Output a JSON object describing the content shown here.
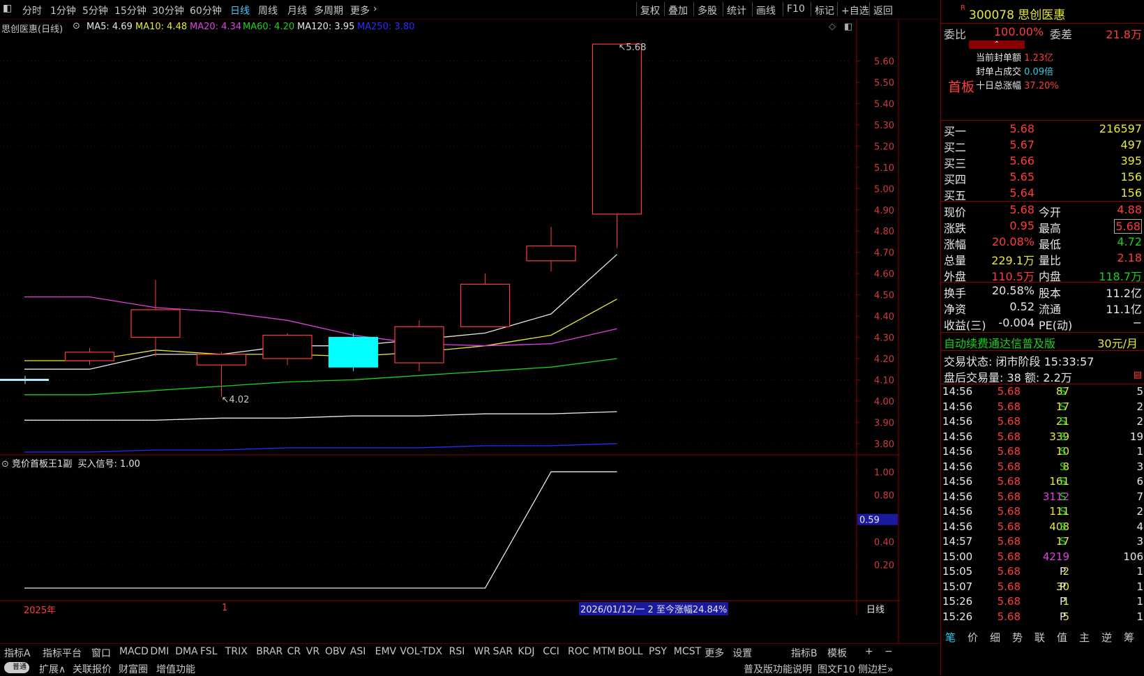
{
  "toolbar": {
    "periods": [
      "分时",
      "1分钟",
      "5分钟",
      "15分钟",
      "30分钟",
      "60分钟",
      "日线",
      "周线",
      "月线",
      "多周期",
      "更多"
    ],
    "active_period": "日线",
    "more_arrow": "›",
    "right_buttons": [
      "复权",
      "叠加",
      "多股",
      "统计",
      "画线",
      "F10",
      "标记",
      "+自选",
      "返回"
    ]
  },
  "legend": {
    "stock_title": "思创医惠(日线)",
    "ma5": "MA5: 4.69",
    "ma10": "MA10: 4.48",
    "ma20": "MA20: 4.34",
    "ma60": "MA60: 4.20",
    "ma120": "MA120: 3.95",
    "ma250": "MA250: 3.80",
    "colors": {
      "ma5": "#e6e6e6",
      "ma10": "#e8e83a",
      "ma20": "#e040e0",
      "ma60": "#19d219",
      "ma120": "#e6e6e6",
      "ma250": "#2a2aff"
    }
  },
  "chart_data": [
    {
      "type": "candlestick",
      "title": "思创医惠(日线)",
      "y_axis_ticks": [
        "5.60",
        "5.50",
        "5.40",
        "5.30",
        "5.20",
        "5.10",
        "5.00",
        "4.90",
        "4.80",
        "4.70",
        "4.60",
        "4.50",
        "4.40",
        "4.30",
        "4.20",
        "4.10",
        "4.00",
        "3.90",
        "3.80"
      ],
      "ylim": [
        3.76,
        5.72
      ],
      "candles": [
        {
          "open": 4.19,
          "close": 4.23,
          "high": 4.25,
          "low": 4.17,
          "dir": "up"
        },
        {
          "open": 4.3,
          "close": 4.43,
          "high": 4.57,
          "low": 4.21,
          "dir": "up"
        },
        {
          "open": 4.17,
          "close": 4.22,
          "high": 4.23,
          "low": 4.02,
          "dir": "up"
        },
        {
          "open": 4.2,
          "close": 4.31,
          "high": 4.32,
          "low": 4.17,
          "dir": "up"
        },
        {
          "open": 4.3,
          "close": 4.16,
          "high": 4.32,
          "low": 4.14,
          "dir": "down"
        },
        {
          "open": 4.18,
          "close": 4.35,
          "high": 4.38,
          "low": 4.14,
          "dir": "up"
        },
        {
          "open": 4.35,
          "close": 4.55,
          "high": 4.6,
          "low": 4.35,
          "dir": "up"
        },
        {
          "open": 4.66,
          "close": 4.73,
          "high": 4.82,
          "low": 4.61,
          "dir": "up"
        },
        {
          "open": 4.88,
          "close": 5.68,
          "high": 5.68,
          "low": 4.72,
          "dir": "up"
        }
      ],
      "annotations": {
        "high_label": "5.68",
        "low_label": "4.02"
      },
      "ma_series": [
        {
          "name": "MA5",
          "values": [
            4.15,
            4.22,
            4.22,
            4.26,
            4.26,
            4.29,
            4.32,
            4.41,
            4.69
          ]
        },
        {
          "name": "MA10",
          "values": [
            4.19,
            4.24,
            4.22,
            4.22,
            4.21,
            4.23,
            4.26,
            4.31,
            4.48
          ]
        },
        {
          "name": "MA20",
          "values": [
            4.49,
            4.44,
            4.42,
            4.38,
            4.31,
            4.27,
            4.26,
            4.27,
            4.34
          ]
        },
        {
          "name": "MA60",
          "values": [
            4.03,
            4.05,
            4.07,
            4.09,
            4.1,
            4.12,
            4.14,
            4.16,
            4.2
          ]
        },
        {
          "name": "MA120",
          "values": [
            3.91,
            3.91,
            3.92,
            3.92,
            3.93,
            3.93,
            3.94,
            3.94,
            3.95
          ]
        },
        {
          "name": "MA250",
          "values": [
            3.76,
            3.77,
            3.77,
            3.78,
            3.78,
            3.78,
            3.79,
            3.79,
            3.8
          ]
        }
      ]
    },
    {
      "type": "line",
      "title": "竞价首板王1副",
      "y_axis_ticks": [
        "1.00",
        "0.80",
        "0.60",
        "0.40",
        "0.20"
      ],
      "ylim": [
        -0.09,
        1.05
      ],
      "series": [
        {
          "name": "买入信号",
          "values": [
            0,
            0,
            0,
            0,
            0,
            0,
            0,
            1,
            1
          ]
        }
      ],
      "cursor_value": "0.59"
    }
  ],
  "sub_legend": {
    "title": "竞价首板王1副",
    "signal": "买入信号: 1.00"
  },
  "x_axis": {
    "year": "2025年",
    "month": "1",
    "range_text": "2026/01/12/一 2 至今涨幅24.84%",
    "period_label": "日线"
  },
  "indicator_tabs": [
    "指标A",
    "指标平台",
    "窗口",
    "MACD",
    "DMI",
    "DMA",
    "FSL",
    "TRIX",
    "BRAR",
    "CR",
    "VR",
    "OBV",
    "ASI",
    "EMV",
    "VOL-TDX",
    "RSI",
    "WR",
    "SAR",
    "KDJ",
    "CCI",
    "ROC",
    "MTM",
    "BOLL",
    "PSY",
    "MCST",
    "更多",
    "设置"
  ],
  "indicator_right": [
    "指标B",
    "模板",
    "+",
    "−"
  ],
  "bottom_bar2": {
    "toggle": "普通",
    "expand": "扩展∧",
    "related": "关联报价",
    "wealth": "财富圈",
    "valueadd": "增值功能",
    "notice": "普及版功能说明",
    "f10": "图文F10",
    "sidebar": "侧边栏»"
  },
  "panel": {
    "r_mark": "R",
    "code_name": "300078 思创医惠",
    "weibi_label": "委比",
    "weibi_value": "100.00%",
    "weicha_label": "委差",
    "weicha_value": "21.8万",
    "caret": "⌃",
    "seal_amount_label": "当前封单额",
    "seal_amount_value": "1.23亿",
    "seal_ratio_label": "封单占成交",
    "seal_ratio_value": "0.09倍",
    "ten_day_label": "十日总涨幅",
    "ten_day_value": "37.20%",
    "tag": "首板",
    "bids": [
      {
        "label": "买一",
        "price": "5.68",
        "vol": "216597"
      },
      {
        "label": "买二",
        "price": "5.67",
        "vol": "497"
      },
      {
        "label": "买三",
        "price": "5.66",
        "vol": "395"
      },
      {
        "label": "买四",
        "price": "5.65",
        "vol": "156"
      },
      {
        "label": "买五",
        "price": "5.64",
        "vol": "156"
      }
    ],
    "quote": [
      {
        "l1": "现价",
        "v1": "5.68",
        "l2": "今开",
        "v2": "4.88",
        "c1": "red",
        "c2": "red"
      },
      {
        "l1": "涨跌",
        "v1": "0.95",
        "l2": "最高",
        "v2": "5.68",
        "c1": "red",
        "c2": "red"
      },
      {
        "l1": "涨幅",
        "v1": "20.08%",
        "l2": "最低",
        "v2": "4.72",
        "c1": "red",
        "c2": "green"
      },
      {
        "l1": "总量",
        "v1": "229.1万",
        "l2": "量比",
        "v2": "2.18",
        "c1": "yellow",
        "c2": "red"
      },
      {
        "l1": "外盘",
        "v1": "110.5万",
        "l2": "内盘",
        "v2": "118.7万",
        "c1": "red",
        "c2": "green"
      }
    ],
    "fund": [
      {
        "l1": "换手",
        "v1": "20.58%",
        "l2": "股本",
        "v2": "11.2亿"
      },
      {
        "l1": "净资",
        "v1": "0.52",
        "l2": "流通",
        "v2": "11.1亿"
      },
      {
        "l1": "收益(三)",
        "v1": "-0.004",
        "l2": "PE(动)",
        "v2": "−"
      }
    ],
    "ad_text": "自动续费通达信普及版",
    "ad_price": "30元/月",
    "trade_status": "交易状态: 闭市阶段 15:33:57",
    "after_hours": "盘后交易量: 38  额: 2.2万",
    "ticks": [
      {
        "t": "14:56",
        "p": "5.68",
        "v": "87",
        "s": "S",
        "n": "5",
        "vc": "yellow"
      },
      {
        "t": "14:56",
        "p": "5.68",
        "v": "17",
        "s": "S",
        "n": "2",
        "vc": "yellow"
      },
      {
        "t": "14:56",
        "p": "5.68",
        "v": "21",
        "s": "S",
        "n": "2",
        "vc": "yellow"
      },
      {
        "t": "14:56",
        "p": "5.68",
        "v": "339",
        "s": "S",
        "n": "19",
        "vc": "yellow"
      },
      {
        "t": "14:56",
        "p": "5.68",
        "v": "10",
        "s": "S",
        "n": "1",
        "vc": "yellow"
      },
      {
        "t": "14:56",
        "p": "5.68",
        "v": "8",
        "s": "S",
        "n": "3",
        "vc": "yellow"
      },
      {
        "t": "14:56",
        "p": "5.68",
        "v": "161",
        "s": "S",
        "n": "6",
        "vc": "yellow"
      },
      {
        "t": "14:56",
        "p": "5.68",
        "v": "3112",
        "s": "S",
        "n": "7",
        "vc": "magenta"
      },
      {
        "t": "14:56",
        "p": "5.68",
        "v": "111",
        "s": "S",
        "n": "2",
        "vc": "yellow"
      },
      {
        "t": "14:56",
        "p": "5.68",
        "v": "408",
        "s": "S",
        "n": "4",
        "vc": "yellow"
      },
      {
        "t": "14:57",
        "p": "5.68",
        "v": "17",
        "s": "S",
        "n": "3",
        "vc": "yellow"
      },
      {
        "t": "15:00",
        "p": "5.68",
        "v": "4219",
        "s": "",
        "n": "106",
        "vc": "magenta"
      },
      {
        "t": "15:05",
        "p": "5.68",
        "v": "2",
        "s": "P",
        "n": "1",
        "vc": "yellow"
      },
      {
        "t": "15:07",
        "p": "5.68",
        "v": "30",
        "s": "P",
        "n": "1",
        "vc": "yellow"
      },
      {
        "t": "15:26",
        "p": "5.68",
        "v": "1",
        "s": "P",
        "n": "1",
        "vc": "yellow"
      },
      {
        "t": "15:26",
        "p": "5.68",
        "v": "5",
        "s": "P",
        "n": "1",
        "vc": "yellow"
      }
    ],
    "bottom_tabs": [
      "笔",
      "价",
      "细",
      "势",
      "联",
      "值",
      "主",
      "逆",
      "筹"
    ]
  }
}
